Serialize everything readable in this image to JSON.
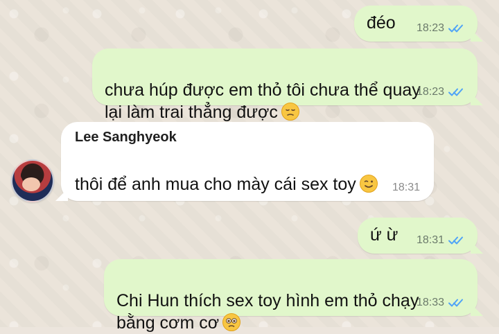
{
  "messages": [
    {
      "text": "đéo",
      "time": "18:23"
    },
    {
      "text": "chưa húp được em thỏ tôi chưa thể quay\nlại làm trai thẳng được",
      "time": "18:23"
    },
    {
      "sender": "Lee Sanghyeok",
      "text": "thôi để anh mua cho mày cái sex toy",
      "time": "18:31"
    },
    {
      "text": "ứ ừ",
      "time": "18:31"
    },
    {
      "text": "Chi Hun thích sex toy hình em thỏ chạy\nbằng cơm cơ",
      "time": "18:33"
    }
  ],
  "colors": {
    "outgoing_bubble": "#e1f7cb",
    "incoming_bubble": "#ffffff",
    "read_ticks": "#4fa3f7",
    "background": "#ebe4da"
  },
  "icons": {
    "read_receipt": "double-check-icon",
    "emoji_pensive": "pensive-face-icon",
    "emoji_wink": "winking-face-icon",
    "emoji_pleading": "pleading-face-icon",
    "avatar": "profile-avatar"
  }
}
